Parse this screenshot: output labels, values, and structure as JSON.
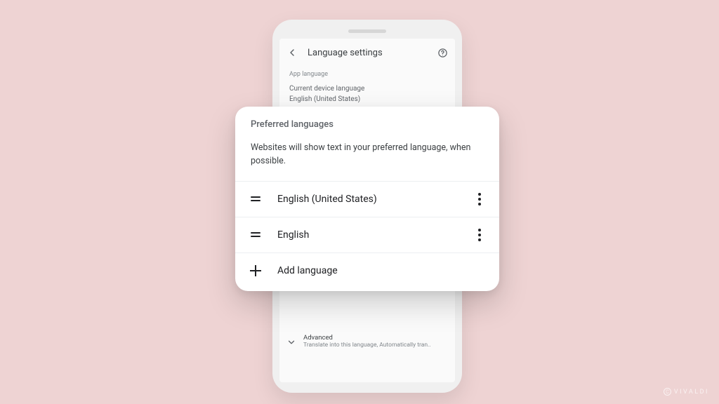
{
  "phone": {
    "appbar": {
      "title": "Language settings"
    },
    "section_label": "App language",
    "current_label": "Current device language",
    "current_value": "English (United States)",
    "advanced": {
      "title": "Advanced",
      "subtitle": "Translate into this language, Automatically tran.."
    }
  },
  "sheet": {
    "title": "Preferred languages",
    "description": "Websites will show text in your preferred language, when possible.",
    "languages": [
      {
        "name": "English (United States)"
      },
      {
        "name": "English"
      }
    ],
    "add_label": "Add language"
  },
  "watermark": "VIVALDI"
}
